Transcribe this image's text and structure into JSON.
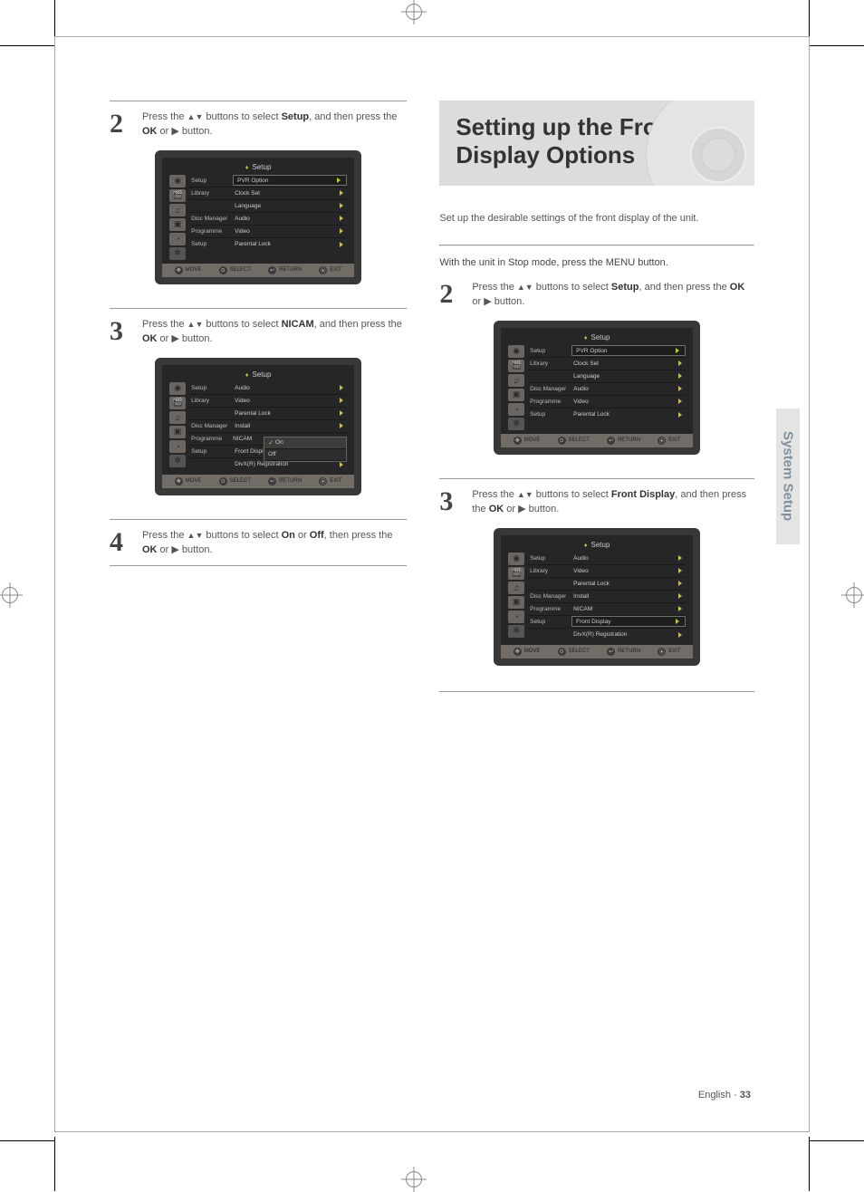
{
  "page": {
    "number": "33",
    "side_tab": "System Setup"
  },
  "title_banner": "Setting up the Front Display Options",
  "intro": "Set up the desirable settings of the front display of the unit.",
  "right_heading": "With the unit in Stop mode, press the MENU button.",
  "left": {
    "step2": {
      "num": "2",
      "text_a": "Press the ",
      "arrows": "▲▼",
      "text_b": " buttons to select ",
      "bold": "Setup",
      "text_c": ", and then press the ",
      "bold2": "OK",
      "text_d": " or ",
      "tri": "▶",
      "text_e": " button."
    },
    "step3": {
      "num": "3",
      "text_a": "Press the ",
      "arrows": "▲▼",
      "text_b": " buttons to select ",
      "bold": "NICAM",
      "text_c": ", and then press the ",
      "bold2": "OK",
      "text_d": " or ",
      "tri": "▶",
      "text_e": " button."
    },
    "step4": {
      "num": "4",
      "text_a": "Press the ",
      "arrows": "▲▼",
      "text_b": " buttons to select ",
      "bold": "On",
      "or_word": " or ",
      "bold_b": "Off",
      "text_c": ", then press the ",
      "bold2": "OK",
      "text_d": " or ",
      "tri": "▶",
      "text_e": " button."
    }
  },
  "right": {
    "step2": {
      "num": "2",
      "text_a": "Press the ",
      "arrows": "▲▼",
      "text_b": " buttons to select ",
      "bold": "Setup",
      "text_c": ", and then press the ",
      "bold2": "OK",
      "text_d": " or ",
      "tri": "▶",
      "text_e": " button."
    },
    "step3": {
      "num": "3",
      "text_a": "Press the ",
      "arrows": "▲▼",
      "text_b": " buttons to select ",
      "bold": "Front Display",
      "text_c": ", and then press the ",
      "bold2": "OK",
      "text_d": " or ",
      "tri": "▶",
      "text_e": " button."
    }
  },
  "tv_footer": {
    "move": "MOVE",
    "select": "SELECT",
    "return": "RETURN",
    "exit": "EXIT"
  },
  "tv_sidebar_glyphs": [
    "◉",
    "🎬",
    "♫",
    "▣",
    "◔",
    "✻"
  ],
  "tv_a": {
    "title": "Setup",
    "rows": [
      {
        "label": "Setup",
        "field": "PVR Option"
      },
      {
        "label": "Library",
        "value": "Clock Set"
      },
      {
        "label": "",
        "value": "Language"
      },
      {
        "label": "Disc Manager",
        "value": "Audio"
      },
      {
        "label": "Programme",
        "value": "Video"
      },
      {
        "label": "Setup",
        "value": "Parental Lock"
      }
    ]
  },
  "tv_b": {
    "title": "Setup",
    "rows": [
      {
        "label": "Setup",
        "value": "Audio"
      },
      {
        "label": "Library",
        "value": "Video"
      },
      {
        "label": "",
        "value": "Parental Lock"
      },
      {
        "label": "Disc Manager",
        "value": "Install"
      },
      {
        "label": "Programme",
        "field": "NICAM"
      },
      {
        "label": "Setup",
        "value": "Front Display"
      },
      {
        "label": "",
        "value": "DivX(R) Registration"
      }
    ],
    "submenu": [
      {
        "label": "On",
        "checked": true
      },
      {
        "label": "Off",
        "checked": false
      }
    ]
  },
  "tv_c": {
    "title": "Setup",
    "rows": [
      {
        "label": "Setup",
        "field": "PVR Option"
      },
      {
        "label": "Library",
        "value": "Clock Set"
      },
      {
        "label": "",
        "value": "Language"
      },
      {
        "label": "Disc Manager",
        "value": "Audio"
      },
      {
        "label": "Programme",
        "value": "Video"
      },
      {
        "label": "Setup",
        "value": "Parental Lock"
      }
    ]
  },
  "tv_d": {
    "title": "Setup",
    "rows": [
      {
        "label": "Setup",
        "value": "Audio"
      },
      {
        "label": "Library",
        "value": "Video"
      },
      {
        "label": "",
        "value": "Parental Lock"
      },
      {
        "label": "Disc Manager",
        "value": "Install"
      },
      {
        "label": "Programme",
        "value": "NICAM"
      },
      {
        "label": "Setup",
        "field": "Front Display"
      },
      {
        "label": "",
        "value": "DivX(R) Registration"
      }
    ]
  }
}
